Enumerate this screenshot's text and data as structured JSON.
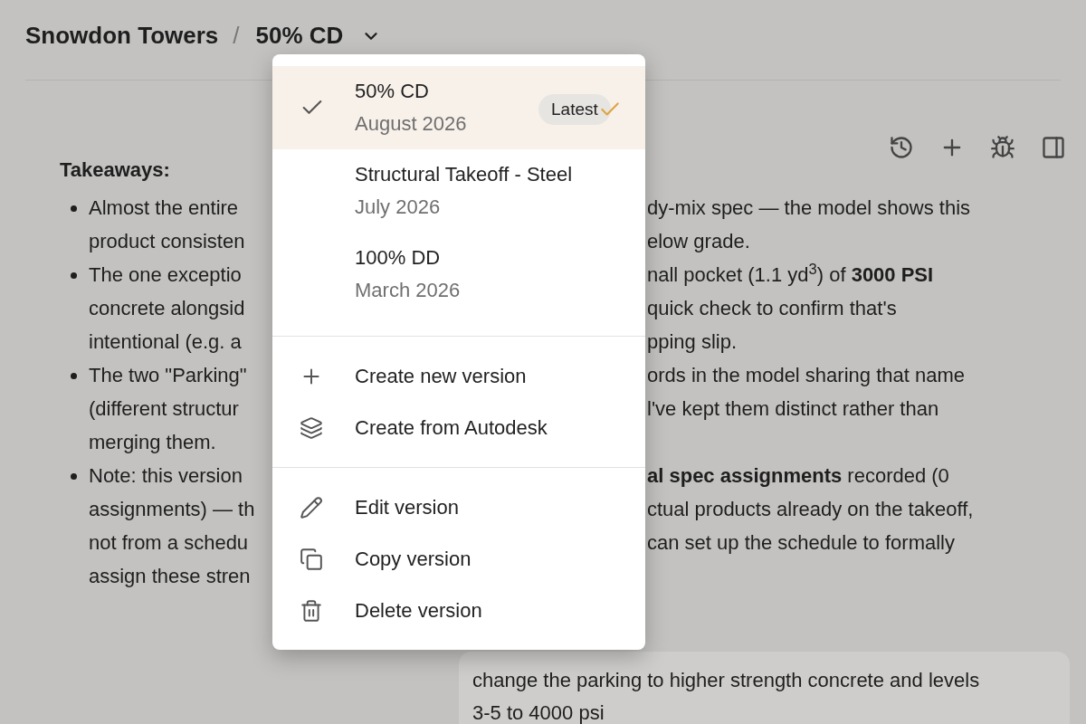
{
  "breadcrumb": {
    "project": "Snowdon Towers",
    "separator": "/",
    "version": "50% CD"
  },
  "content": {
    "heading": "Takeaways:",
    "bullets": [
      {
        "lines": [
          {
            "left": "Almost the entire",
            "right": "dy-mix spec — the model shows this"
          },
          {
            "left": "product consisten",
            "right": "elow grade."
          }
        ]
      },
      {
        "lines": [
          {
            "left": "The one exceptio",
            "right": "nall pocket (1.1 yd$^{3}$) of **3000 PSI**"
          },
          {
            "left": "concrete alongsid",
            "right": "quick check to confirm that's"
          },
          {
            "left": "intentional (e.g. a",
            "right": "pping slip."
          }
        ]
      },
      {
        "lines": [
          {
            "left": "The two \"Parking\"",
            "right": "ords in the model sharing that name"
          },
          {
            "left": "(different structur",
            "right": "l've kept them distinct rather than"
          },
          {
            "left": "merging them."
          }
        ]
      },
      {
        "lines": [
          {
            "left": "Note: this version",
            "right": "**al spec assignments** recorded (0"
          },
          {
            "left": "assignments) — th",
            "right": "ctual products already on the takeoff,"
          },
          {
            "left": "not from a schedu",
            "right": "can set up the schedule to formally"
          },
          {
            "left": "assign these stren"
          }
        ]
      }
    ]
  },
  "user_message": "change the parking to higher strength concrete and levels 3-5 to 4000 psi",
  "version_menu": {
    "versions": [
      {
        "title": "50% CD",
        "date": "August 2026",
        "selected": true,
        "badge": "Latest"
      },
      {
        "title": "Structural Takeoff - Steel",
        "date": "July 2026",
        "selected": false
      },
      {
        "title": "100% DD",
        "date": "March 2026",
        "selected": false
      }
    ],
    "create_actions": [
      {
        "kind": "plus",
        "label": "Create new version"
      },
      {
        "kind": "layers",
        "label": "Create from Autodesk"
      }
    ],
    "edit_actions": [
      {
        "kind": "pencil",
        "label": "Edit version"
      },
      {
        "kind": "copy",
        "label": "Copy version"
      },
      {
        "kind": "trash",
        "label": "Delete version"
      }
    ]
  }
}
